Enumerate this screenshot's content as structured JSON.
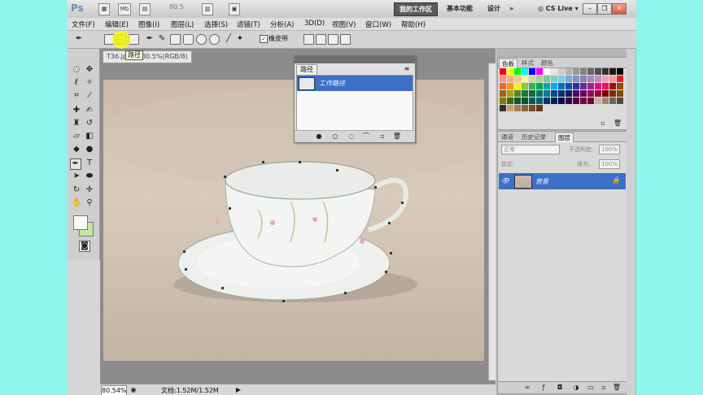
{
  "titlebar": {
    "logo": "Ps",
    "mb_label": "Mb",
    "zoom_value": "80.5",
    "workspace_tabs": [
      {
        "label": "我的工作区",
        "active": true
      },
      {
        "label": "基本功能",
        "active": false
      },
      {
        "label": "设计",
        "active": false
      }
    ],
    "more_label": "»",
    "cslive_label": "CS Live"
  },
  "menu": [
    "文件(F)",
    "编辑(E)",
    "图像(I)",
    "图层(L)",
    "选择(S)",
    "滤镜(T)",
    "分析(A)",
    "3D(D)",
    "视图(V)",
    "窗口(W)",
    "帮助(H)"
  ],
  "options": {
    "checkbox_label": "橡皮带",
    "tooltip": "路径"
  },
  "document": {
    "tab_title": "T36.jpg @ 80.5%(RGB/8)",
    "zoom": "80.54%",
    "doc_info": "文档:1.52M/1.52M"
  },
  "paths_panel": {
    "tab": "路径",
    "path_name": "工作路径"
  },
  "swatches_panel": {
    "tabs": [
      "色板",
      "样式",
      "颜色"
    ],
    "colors": [
      "#ff0000",
      "#ffff00",
      "#00ff00",
      "#00ffff",
      "#0000ff",
      "#ff00ff",
      "#ffffff",
      "#e6e6e6",
      "#cccccc",
      "#b3b3b3",
      "#999999",
      "#808080",
      "#666666",
      "#4d4d4d",
      "#333333",
      "#1a1a1a",
      "#000000",
      "#f7977a",
      "#f9ad81",
      "#fdc68a",
      "#fff79a",
      "#c4df9b",
      "#a2d39c",
      "#82ca9d",
      "#7bcdc8",
      "#6ecff6",
      "#7ea7d8",
      "#8493ca",
      "#8882be",
      "#a187be",
      "#bc8dbf",
      "#f49ac2",
      "#f6989d",
      "#ed1c24",
      "#f26522",
      "#f7941d",
      "#fff200",
      "#8dc63f",
      "#39b54a",
      "#00a651",
      "#00a99d",
      "#00aeef",
      "#0072bc",
      "#0054a6",
      "#2e3192",
      "#662d91",
      "#92278f",
      "#ec008c",
      "#ed145b",
      "#9e0b0f",
      "#a0410d",
      "#a3620a",
      "#aba000",
      "#598527",
      "#197b30",
      "#007236",
      "#00746b",
      "#0076a3",
      "#004a80",
      "#003471",
      "#1b1464",
      "#440e62",
      "#630460",
      "#9e005d",
      "#9e0039",
      "#790000",
      "#7b2e00",
      "#7d4900",
      "#827b00",
      "#406618",
      "#005e20",
      "#005826",
      "#005952",
      "#005b7f",
      "#003663",
      "#002157",
      "#0d004c",
      "#32004b",
      "#4b0049",
      "#7b0046",
      "#7a0026",
      "#c7b299",
      "#998675",
      "#736357",
      "#534741",
      "#37302d",
      "#c69c6d",
      "#a67c52",
      "#8c6239",
      "#754c24",
      "#603913"
    ]
  },
  "layers_panel": {
    "tabs": [
      "通道",
      "历史记录",
      "图层"
    ],
    "blend_mode": "正常",
    "opacity_label": "不透明度:",
    "opacity_value": "100%",
    "lock_label": "锁定:",
    "fill_label": "填充:",
    "fill_value": "100%",
    "layer_name": "背景"
  }
}
